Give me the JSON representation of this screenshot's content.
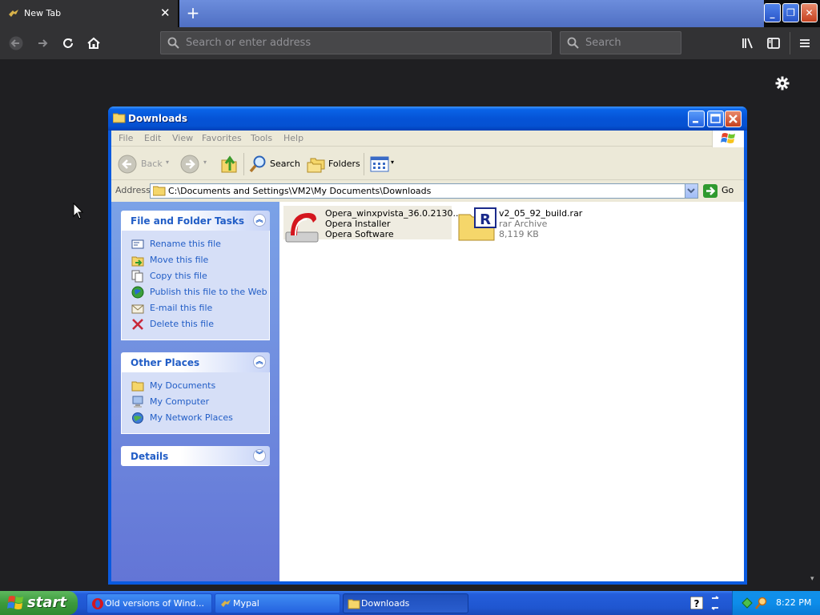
{
  "browser": {
    "tab_title": "New Tab",
    "tab_close": "✕",
    "new_tab": "+",
    "url_placeholder": "Search or enter address",
    "search_placeholder": "Search",
    "window_controls": {
      "minimize": "_",
      "restore": "❐",
      "close": "✕"
    }
  },
  "explorer": {
    "title": "Downloads",
    "menu": [
      "File",
      "Edit",
      "View",
      "Favorites",
      "Tools",
      "Help"
    ],
    "toolbar": {
      "back": "Back",
      "search": "Search",
      "folders": "Folders"
    },
    "address_label": "Address",
    "address_value": "C:\\Documents and Settings\\VM2\\My Documents\\Downloads",
    "go_label": "Go",
    "file_tasks": {
      "title": "File and Folder Tasks",
      "items": [
        {
          "label": "Rename this file",
          "icon": "rename-icon"
        },
        {
          "label": "Move this file",
          "icon": "move-icon"
        },
        {
          "label": "Copy this file",
          "icon": "copy-icon"
        },
        {
          "label": "Publish this file to the Web",
          "icon": "globe-icon"
        },
        {
          "label": "E-mail this file",
          "icon": "email-icon"
        },
        {
          "label": "Delete this file",
          "icon": "delete-icon"
        }
      ]
    },
    "other_places": {
      "title": "Other Places",
      "items": [
        {
          "label": "My Documents",
          "icon": "folder-icon"
        },
        {
          "label": "My Computer",
          "icon": "computer-icon"
        },
        {
          "label": "My Network Places",
          "icon": "network-icon"
        }
      ]
    },
    "details": {
      "title": "Details"
    },
    "files": [
      {
        "name": "Opera_winxpvista_36.0.2130...",
        "type": "Opera Installer",
        "meta": "Opera Software",
        "icon": "opera-installer-icon"
      },
      {
        "name": "v2_05_92_build.rar",
        "type": "rar Archive",
        "meta": "8,119 KB",
        "icon": "rar-archive-icon"
      }
    ]
  },
  "taskbar": {
    "start": "start",
    "buttons": [
      {
        "label": "Old versions of Wind...",
        "icon": "opera-icon"
      },
      {
        "label": "Mypal",
        "icon": "mypal-icon"
      },
      {
        "label": "Downloads",
        "icon": "folder-icon"
      }
    ],
    "clock": "8:22 PM"
  },
  "colors": {
    "xp_blue": "#0553d6",
    "task_link": "#215dc6",
    "firefox_dark": "#323234",
    "start_green": "#3c9a3c"
  }
}
